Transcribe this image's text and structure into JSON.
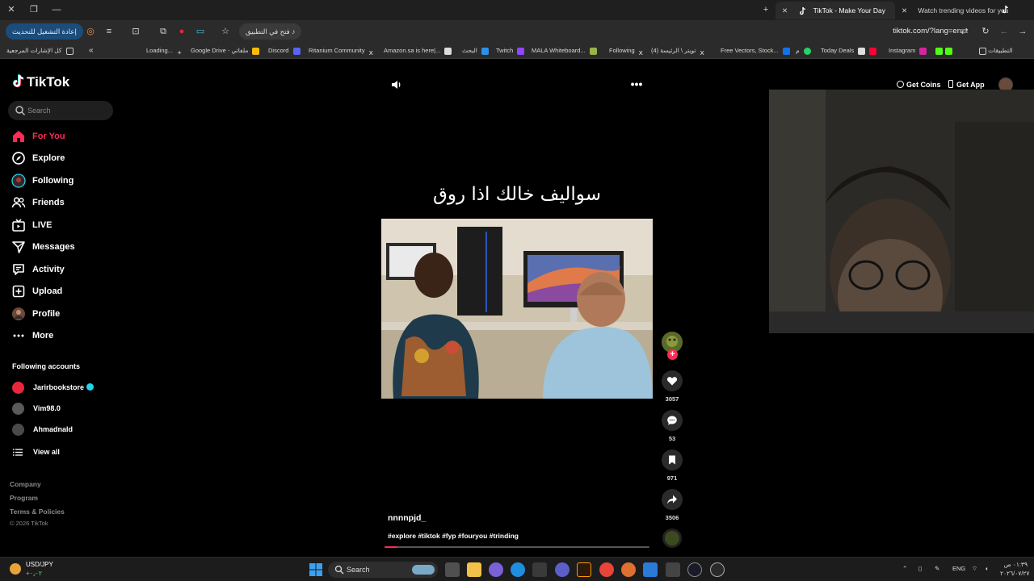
{
  "browser": {
    "tabs": [
      {
        "title": "TikTok - Make Your Day",
        "active": true
      },
      {
        "title": "Watch trending videos for you",
        "active": false
      }
    ],
    "reload_button_label": "إعادة التشغيل للتحديث",
    "open_in_app_label": "فتح في التطبيق",
    "url": "tiktok.com/?lang=en",
    "bookmarks": [
      {
        "label": "التطبيقات",
        "icon": "apps-icon"
      },
      {
        "label": "Instagram",
        "icon": "instagram-icon"
      },
      {
        "label": "Today Deals",
        "icon": "amazon-icon"
      },
      {
        "label": "م",
        "icon": "whatsapp-icon"
      },
      {
        "label": "Free Vectors, Stock...",
        "icon": "freepik-icon"
      },
      {
        "label": "(4) تويتر \\ الرئيسة",
        "icon": "x-icon"
      },
      {
        "label": "Following",
        "icon": "x-icon"
      },
      {
        "label": "MALA Whiteboard...",
        "icon": "mala-icon"
      },
      {
        "label": "Twitch",
        "icon": "twitch-icon"
      },
      {
        "label": "البحث",
        "icon": "bookmark-icon"
      },
      {
        "label": "Amazon.sa is here|...",
        "icon": "amazon-icon"
      },
      {
        "label": "Ritanium Community",
        "icon": "x-icon"
      },
      {
        "label": "Discord",
        "icon": "discord-icon"
      },
      {
        "label": "Google Drive - ملفاتي",
        "icon": "drive-icon"
      },
      {
        "label": "Loading...",
        "icon": "loading-icon"
      },
      {
        "label": "كل الإشارات المرجعية",
        "icon": "folder-icon"
      }
    ]
  },
  "sidebar": {
    "logo": "TikTok",
    "search_placeholder": "Search",
    "nav": [
      {
        "label": "For You",
        "icon": "home-icon"
      },
      {
        "label": "Explore",
        "icon": "compass-icon"
      },
      {
        "label": "Following",
        "icon": "following-icon"
      },
      {
        "label": "Friends",
        "icon": "friends-icon"
      },
      {
        "label": "LIVE",
        "icon": "live-icon"
      },
      {
        "label": "Messages",
        "icon": "send-icon"
      },
      {
        "label": "Activity",
        "icon": "activity-icon"
      },
      {
        "label": "Upload",
        "icon": "upload-icon"
      },
      {
        "label": "Profile",
        "icon": "profile-icon"
      },
      {
        "label": "More",
        "icon": "more-icon"
      }
    ],
    "following_title": "Following accounts",
    "accounts": [
      {
        "name": "Jarirbookstore",
        "verified": true,
        "color": "#e8283a"
      },
      {
        "name": "Vim98.0",
        "verified": false,
        "color": "#5a5a5a"
      },
      {
        "name": "Ahmadnald",
        "verified": false,
        "color": "#4a4a4a"
      }
    ],
    "view_all": "View all",
    "footer_links": [
      "Company",
      "Program",
      "Terms & Policies"
    ],
    "copyright": "© 2026 TikTok"
  },
  "video": {
    "caption": "سواليف خالك اذا روق",
    "username": "nnnnpjd_",
    "hashtags": "#explore #tiktok #fyp #fouryou #trinding",
    "progress": 0.05,
    "likes": "3057",
    "comments": "53",
    "saves": "971",
    "shares": "3506"
  },
  "header": {
    "get_coins": "Get Coins",
    "get_app": "Get App"
  },
  "taskbar": {
    "ticker": "USD/JPY",
    "ticker_change": "+٠٫٠٢",
    "search_label": "Search",
    "language": "ENG",
    "time": "٠١:٣٩ ص",
    "date": "٢٠٢٦/٠٧/٢٧"
  },
  "colors": {
    "accent": "#fe2c55",
    "background": "#000000",
    "verified": "#20d5ec"
  }
}
